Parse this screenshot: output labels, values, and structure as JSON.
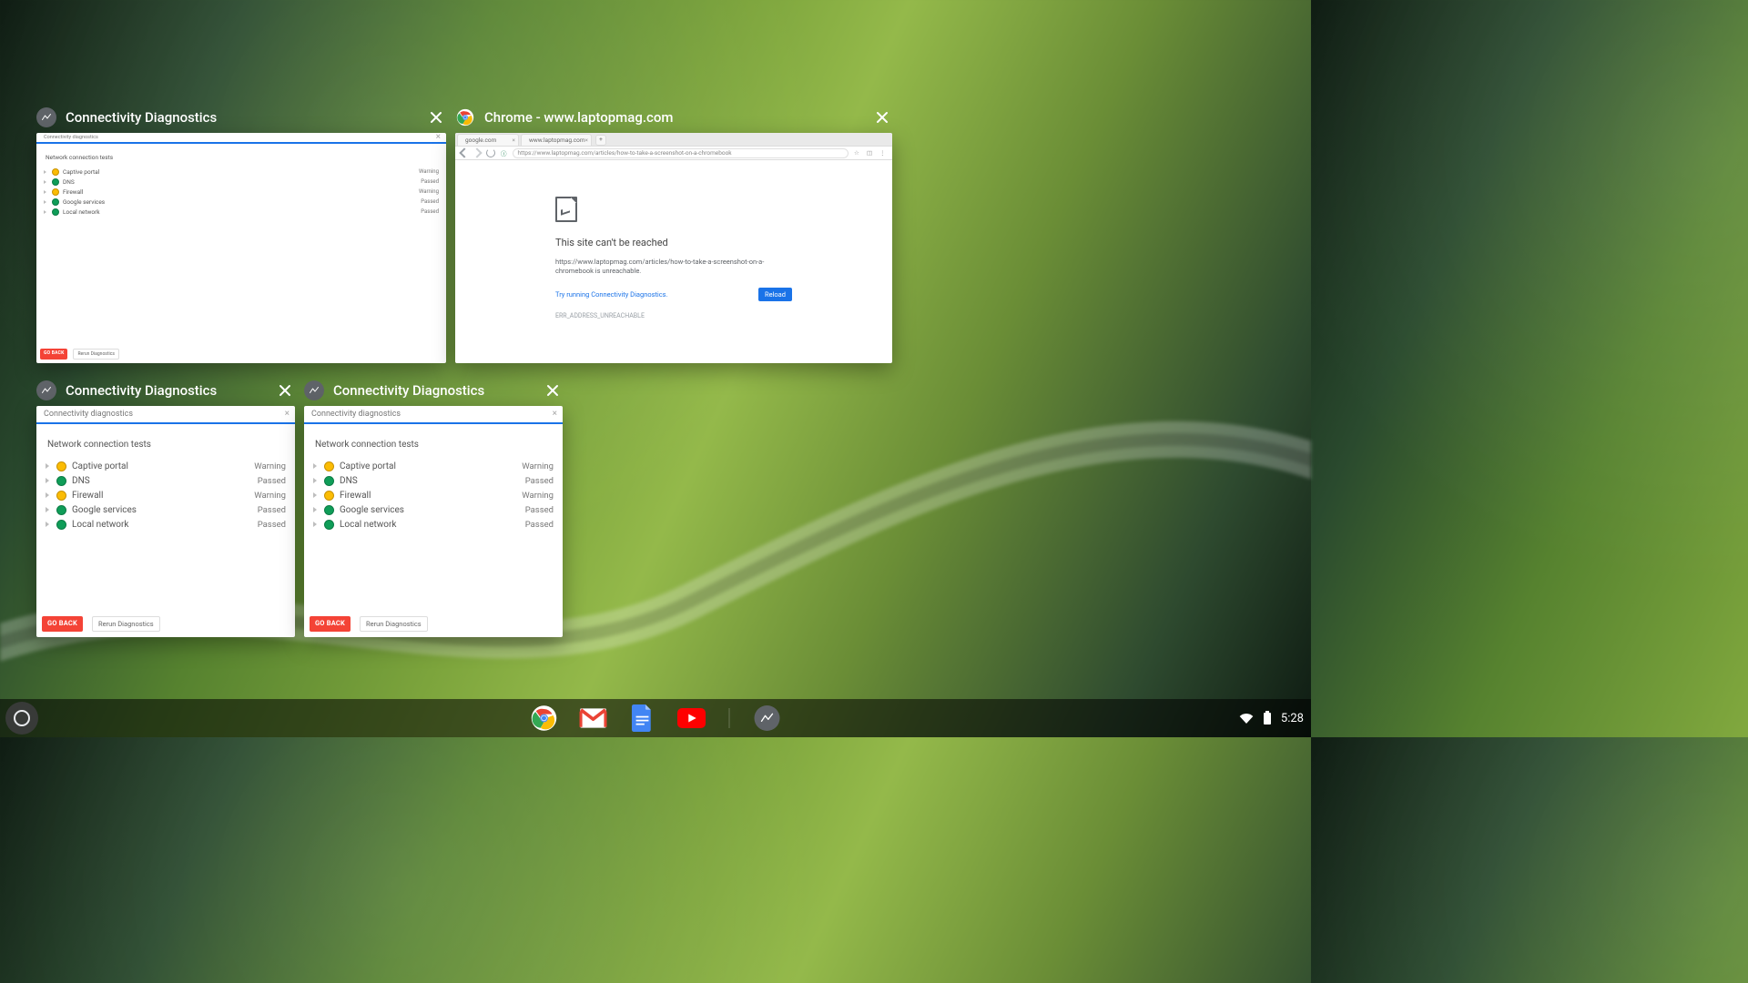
{
  "overview": {
    "windows": [
      {
        "id": "w1",
        "kind": "diagnostics",
        "title": "Connectivity Diagnostics",
        "app_tab": "Connectivity diagnostics",
        "tests_heading": "Network connection tests",
        "tests": [
          {
            "name": "Captive portal",
            "status": "Warning",
            "state": "warn"
          },
          {
            "name": "DNS",
            "status": "Passed",
            "state": "pass"
          },
          {
            "name": "Firewall",
            "status": "Warning",
            "state": "warn"
          },
          {
            "name": "Google services",
            "status": "Passed",
            "state": "pass"
          },
          {
            "name": "Local network",
            "status": "Passed",
            "state": "pass"
          }
        ],
        "buttons": {
          "back": "GO BACK",
          "rerun": "Rerun Diagnostics"
        }
      },
      {
        "id": "w2",
        "kind": "chrome",
        "title": "Chrome - www.laptopmag.com",
        "tabs": [
          {
            "label": "google.com"
          },
          {
            "label": "www.laptopmag.com"
          }
        ],
        "address": "https://www.laptopmag.com/articles/how-to-take-a-screenshot-on-a-chromebook",
        "error": {
          "heading": "This site can't be reached",
          "body": "https://www.laptopmag.com/articles/how-to-take-a-screenshot-on-a-chromebook is unreachable.",
          "suggest": "Try running Connectivity Diagnostics.",
          "code": "ERR_ADDRESS_UNREACHABLE",
          "button": "Reload"
        }
      },
      {
        "id": "w3",
        "kind": "diagnostics",
        "title": "Connectivity Diagnostics",
        "app_tab": "Connectivity diagnostics",
        "tests_heading": "Network connection tests",
        "tests": [
          {
            "name": "Captive portal",
            "status": "Warning",
            "state": "warn"
          },
          {
            "name": "DNS",
            "status": "Passed",
            "state": "pass"
          },
          {
            "name": "Firewall",
            "status": "Warning",
            "state": "warn"
          },
          {
            "name": "Google services",
            "status": "Passed",
            "state": "pass"
          },
          {
            "name": "Local network",
            "status": "Passed",
            "state": "pass"
          }
        ],
        "buttons": {
          "back": "GO BACK",
          "rerun": "Rerun Diagnostics"
        }
      },
      {
        "id": "w4",
        "kind": "diagnostics",
        "title": "Connectivity Diagnostics",
        "app_tab": "Connectivity diagnostics",
        "tests_heading": "Network connection tests",
        "tests": [
          {
            "name": "Captive portal",
            "status": "Warning",
            "state": "warn"
          },
          {
            "name": "DNS",
            "status": "Passed",
            "state": "pass"
          },
          {
            "name": "Firewall",
            "status": "Warning",
            "state": "warn"
          },
          {
            "name": "Google services",
            "status": "Passed",
            "state": "pass"
          },
          {
            "name": "Local network",
            "status": "Passed",
            "state": "pass"
          }
        ],
        "buttons": {
          "back": "GO BACK",
          "rerun": "Rerun Diagnostics"
        }
      }
    ]
  },
  "shelf": {
    "apps": [
      "chrome",
      "gmail",
      "docs",
      "youtube",
      "diagnostics"
    ]
  },
  "status": {
    "time": "5:28"
  }
}
